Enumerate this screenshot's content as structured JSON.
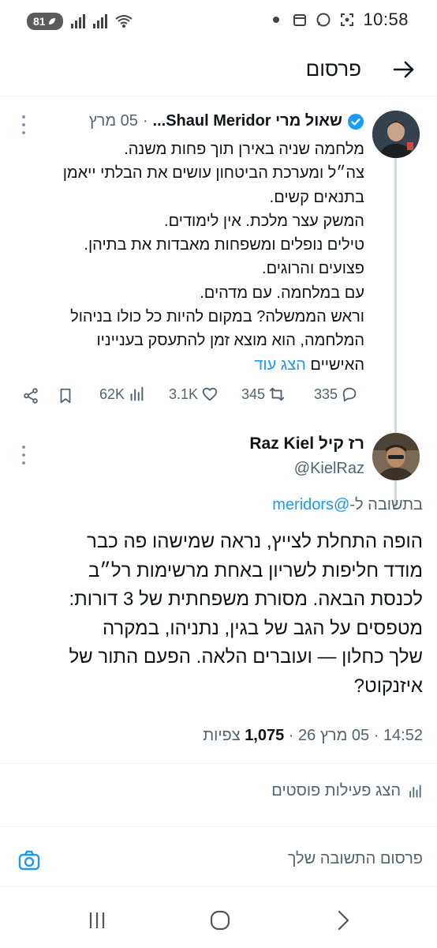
{
  "status_bar": {
    "battery": "81",
    "time": "10:58"
  },
  "header": {
    "title": "פרסום"
  },
  "quoted_post": {
    "display_name": "שאול מרי Shaul Meridor...",
    "date": "05 מרץ",
    "lines": [
      "מלחמה שניה באירן תוך פחות משנה.",
      "צה״ל ומערכת הביטחון עושים את הבלתי ייאמן",
      "בתנאים קשים.",
      "המשק עצר מלכת. אין לימודים.",
      "טילים נופלים ומשפחות מאבדות את בתיהן.",
      "פצועים והרוגים.",
      "עם במלחמה. עם מדהים.",
      "וראש הממשלה? במקום להיות כל כולו בניהול",
      "המלחמה, הוא מוצא זמן להתעסק בענייניו",
      "האישיים"
    ],
    "show_more": "הצג עוד",
    "stats": {
      "replies": "335",
      "reposts": "345",
      "likes": "3.1K",
      "views": "62K"
    }
  },
  "reply_post": {
    "display_name": "רז קיל Raz Kiel",
    "handle": "@KielRaz",
    "replying_to_prefix": "בתשובה ל-",
    "replying_to_handle": "@meridors",
    "lines": [
      "הופה התחלת לצייץ, נראה שמישהו פה כבר",
      "מודד חליפות לשריון באחת מרשימות רל״ב",
      "לכנסת הבאה. מסורת משפחתית של 3 דורות:",
      "מטפסים על הגב של בגין, נתניהו, במקרה",
      "שלך כחלון — ועוברים הלאה. הפעם התור של",
      "איזנקוט?"
    ],
    "time": "14:52",
    "date": "05 מרץ 26",
    "views_count": "1,075",
    "views_label": "צפיות"
  },
  "activity": {
    "label": "הצג פעילות פוסטים"
  },
  "compose": {
    "placeholder": "פרסום התשובה שלך"
  },
  "colors": {
    "accent": "#1d9bf0",
    "secondary_text": "#536471",
    "primary_text": "#0f1419"
  }
}
